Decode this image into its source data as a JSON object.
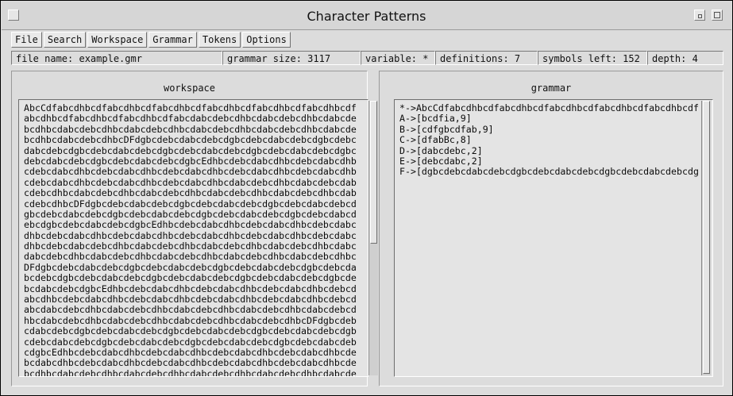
{
  "window": {
    "title": "Character Patterns"
  },
  "menu": [
    "File",
    "Search",
    "Workspace",
    "Grammar",
    "Tokens",
    "Options"
  ],
  "status": {
    "file_name": "file name: example.gmr",
    "grammar_size": "grammar size: 3117",
    "variable": "variable: *",
    "definitions": "definitions: 7",
    "symbols_left": "symbols left: 152",
    "depth": "depth: 4"
  },
  "workspace": {
    "title": "workspace",
    "lines": [
      "AbcCdfabcdhbcdfabcdhbcdfabcdhbcdfabcdhbcdfabcdhbcdfabcdhbcdf",
      "abcdhbcdfabcdhbcdfabcdhbcdfabcdabcdebcdhbcdabcdebcdhbcdabcde",
      "bcdhbcdabcdebcdhbcdabcdebcdhbcdabcdebcdhbcdabcdebcdhbcdabcde",
      "bcdhbcdabcdebcdhbcDFdgbcdebcdabcdebcdgbcdebcdabcdebcdgbcdebc",
      "dabcdebcdgbcdebcdabcdebcdgbcdebcdabcdebcdgbcdebcdabcdebcdgbc",
      "debcdabcdebcdgbcdebcdabcdebcdgbcEdhbcdebcdabcdhbcdebcdabcdhb",
      "cdebcdabcdhbcdebcdabcdhbcdebcdabcdhbcdebcdabcdhbcdebcdabcdhb",
      "cdebcdabcdhbcdebcdabcdhbcdebcdabcdhbcdabcdebcdhbcdabcdebcdab",
      "cdebcdhbcdabcdebcdhbcdabcdebcdhbcdabcdebcdhbcdabcdebcdhbcdab",
      "cdebcdhbcDFdgbcdebcdabcdebcdgbcdebcdabcdebcdgbcdebcdabcdebcd",
      "gbcdebcdabcdebcdgbcdebcdabcdebcdgbcdebcdabcdebcdgbcdebcdabcd",
      "ebcdgbcdebcdabcdebcdgbcEdhbcdebcdabcdhbcdebcdabcdhbcdebcdabc",
      "dhbcdebcdabcdhbcdebcdabcdhbcdebcdabcdhbcdebcdabcdhbcdebcdabc",
      "dhbcdebcdabcdebcdhbcdabcdebcdhbcdabcdebcdhbcdabcdebcdhbcdabc",
      "dabcdebcdhbcdabcdebcdhbcdabcdebcdhbcdabcdebcdhbcdabcdebcdhbc",
      "DFdgbcdebcdabcdebcdgbcdebcdabcdebcdgbcdebcdabcdebcdgbcdebcda",
      "bcdebcdgbcdebcdabcdebcdgbcdebcdabcdebcdgbcdebcdabcdebcdgbcde",
      "bcdabcdebcdgbcEdhbcdebcdabcdhbcdebcdabcdhbcdebcdabcdhbcdebcd",
      "abcdhbcdebcdabcdhbcdebcdabcdhbcdebcdabcdhbcdebcdabcdhbcdebcd",
      "abcdabcdebcdhbcdabcdebcdhbcdabcdebcdhbcdabcdebcdhbcdabcdebcd",
      "hbcdabcdebcdhbcdabcdebcdhbcdabcdebcdhbcdabcdebcdhbcDFdgbcdeb",
      "cdabcdebcdgbcdebcdabcdebcdgbcdebcdabcdebcdgbcdebcdabcdebcdgb",
      "cdebcdabcdebcdgbcdebcdabcdebcdgbcdebcdabcdebcdgbcdebcdabcdeb",
      "cdgbcEdhbcdebcdabcdhbcdebcdabcdhbcdebcdabcdhbcdebcdabcdhbcde",
      "bcdabcdhbcdebcdabcdhbcdebcdabcdhbcdebcdabcdhbcdebcdabcdhbcde",
      "bcdhbcdabcdebcdhbcdabcdebcdhbcdabcdebcdhbcdabcdebcdhbcdabcde"
    ]
  },
  "grammar": {
    "title": "grammar",
    "lines": [
      "*->AbcCdfabcdhbcdfabcdhbcdfabcdhbcdfabcdhbcdfabcdhbcdf",
      "A->[bcdfia,9]",
      "B->[cdfgbcdfab,9]",
      "C->[dfabBc,8]",
      "D->[dabcdebc,2]",
      "E->[debcdabc,2]",
      "F->[dgbcdebcdabcdebcdgbcdebcdabcdebcdgbcdebcdabcdebcdg"
    ]
  }
}
